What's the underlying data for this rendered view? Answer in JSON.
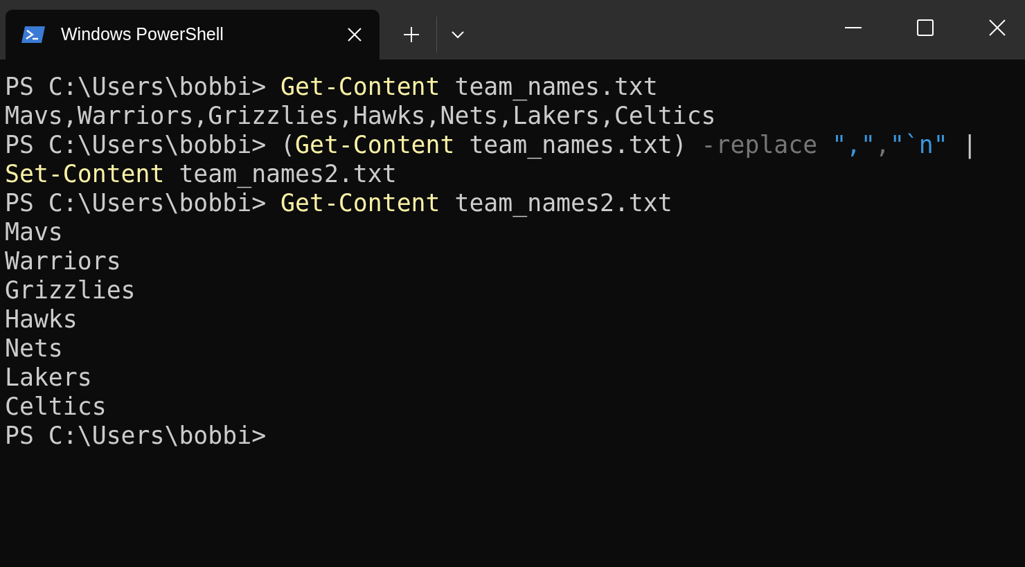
{
  "tab": {
    "title": "Windows PowerShell",
    "selected": true
  },
  "lines": [
    {
      "segments": [
        {
          "kind": "plain",
          "text": "PS C:\\Users\\bobbi> "
        },
        {
          "kind": "command",
          "text": "Get-Content"
        },
        {
          "kind": "plain",
          "text": " team_names.txt"
        }
      ]
    },
    {
      "segments": [
        {
          "kind": "plain",
          "text": "Mavs,Warriors,Grizzlies,Hawks,Nets,Lakers,Celtics"
        }
      ]
    },
    {
      "segments": [
        {
          "kind": "plain",
          "text": "PS C:\\Users\\bobbi> ("
        },
        {
          "kind": "command",
          "text": "Get-Content"
        },
        {
          "kind": "plain",
          "text": " team_names.txt) "
        },
        {
          "kind": "parameter",
          "text": "-replace "
        },
        {
          "kind": "string",
          "text": "\",\""
        },
        {
          "kind": "parameter",
          "text": ","
        },
        {
          "kind": "string",
          "text": "\"`n\""
        },
        {
          "kind": "plain",
          "text": " |"
        }
      ]
    },
    {
      "segments": [
        {
          "kind": "command",
          "text": "Set-Content"
        },
        {
          "kind": "plain",
          "text": " team_names2.txt"
        }
      ]
    },
    {
      "segments": [
        {
          "kind": "plain",
          "text": "PS C:\\Users\\bobbi> "
        },
        {
          "kind": "command",
          "text": "Get-Content"
        },
        {
          "kind": "plain",
          "text": " team_names2.txt"
        }
      ]
    },
    {
      "segments": [
        {
          "kind": "plain",
          "text": "Mavs"
        }
      ]
    },
    {
      "segments": [
        {
          "kind": "plain",
          "text": "Warriors"
        }
      ]
    },
    {
      "segments": [
        {
          "kind": "plain",
          "text": "Grizzlies"
        }
      ]
    },
    {
      "segments": [
        {
          "kind": "plain",
          "text": "Hawks"
        }
      ]
    },
    {
      "segments": [
        {
          "kind": "plain",
          "text": "Nets"
        }
      ]
    },
    {
      "segments": [
        {
          "kind": "plain",
          "text": "Lakers"
        }
      ]
    },
    {
      "segments": [
        {
          "kind": "plain",
          "text": "Celtics"
        }
      ]
    },
    {
      "segments": [
        {
          "kind": "plain",
          "text": "PS C:\\Users\\bobbi>"
        }
      ]
    }
  ]
}
